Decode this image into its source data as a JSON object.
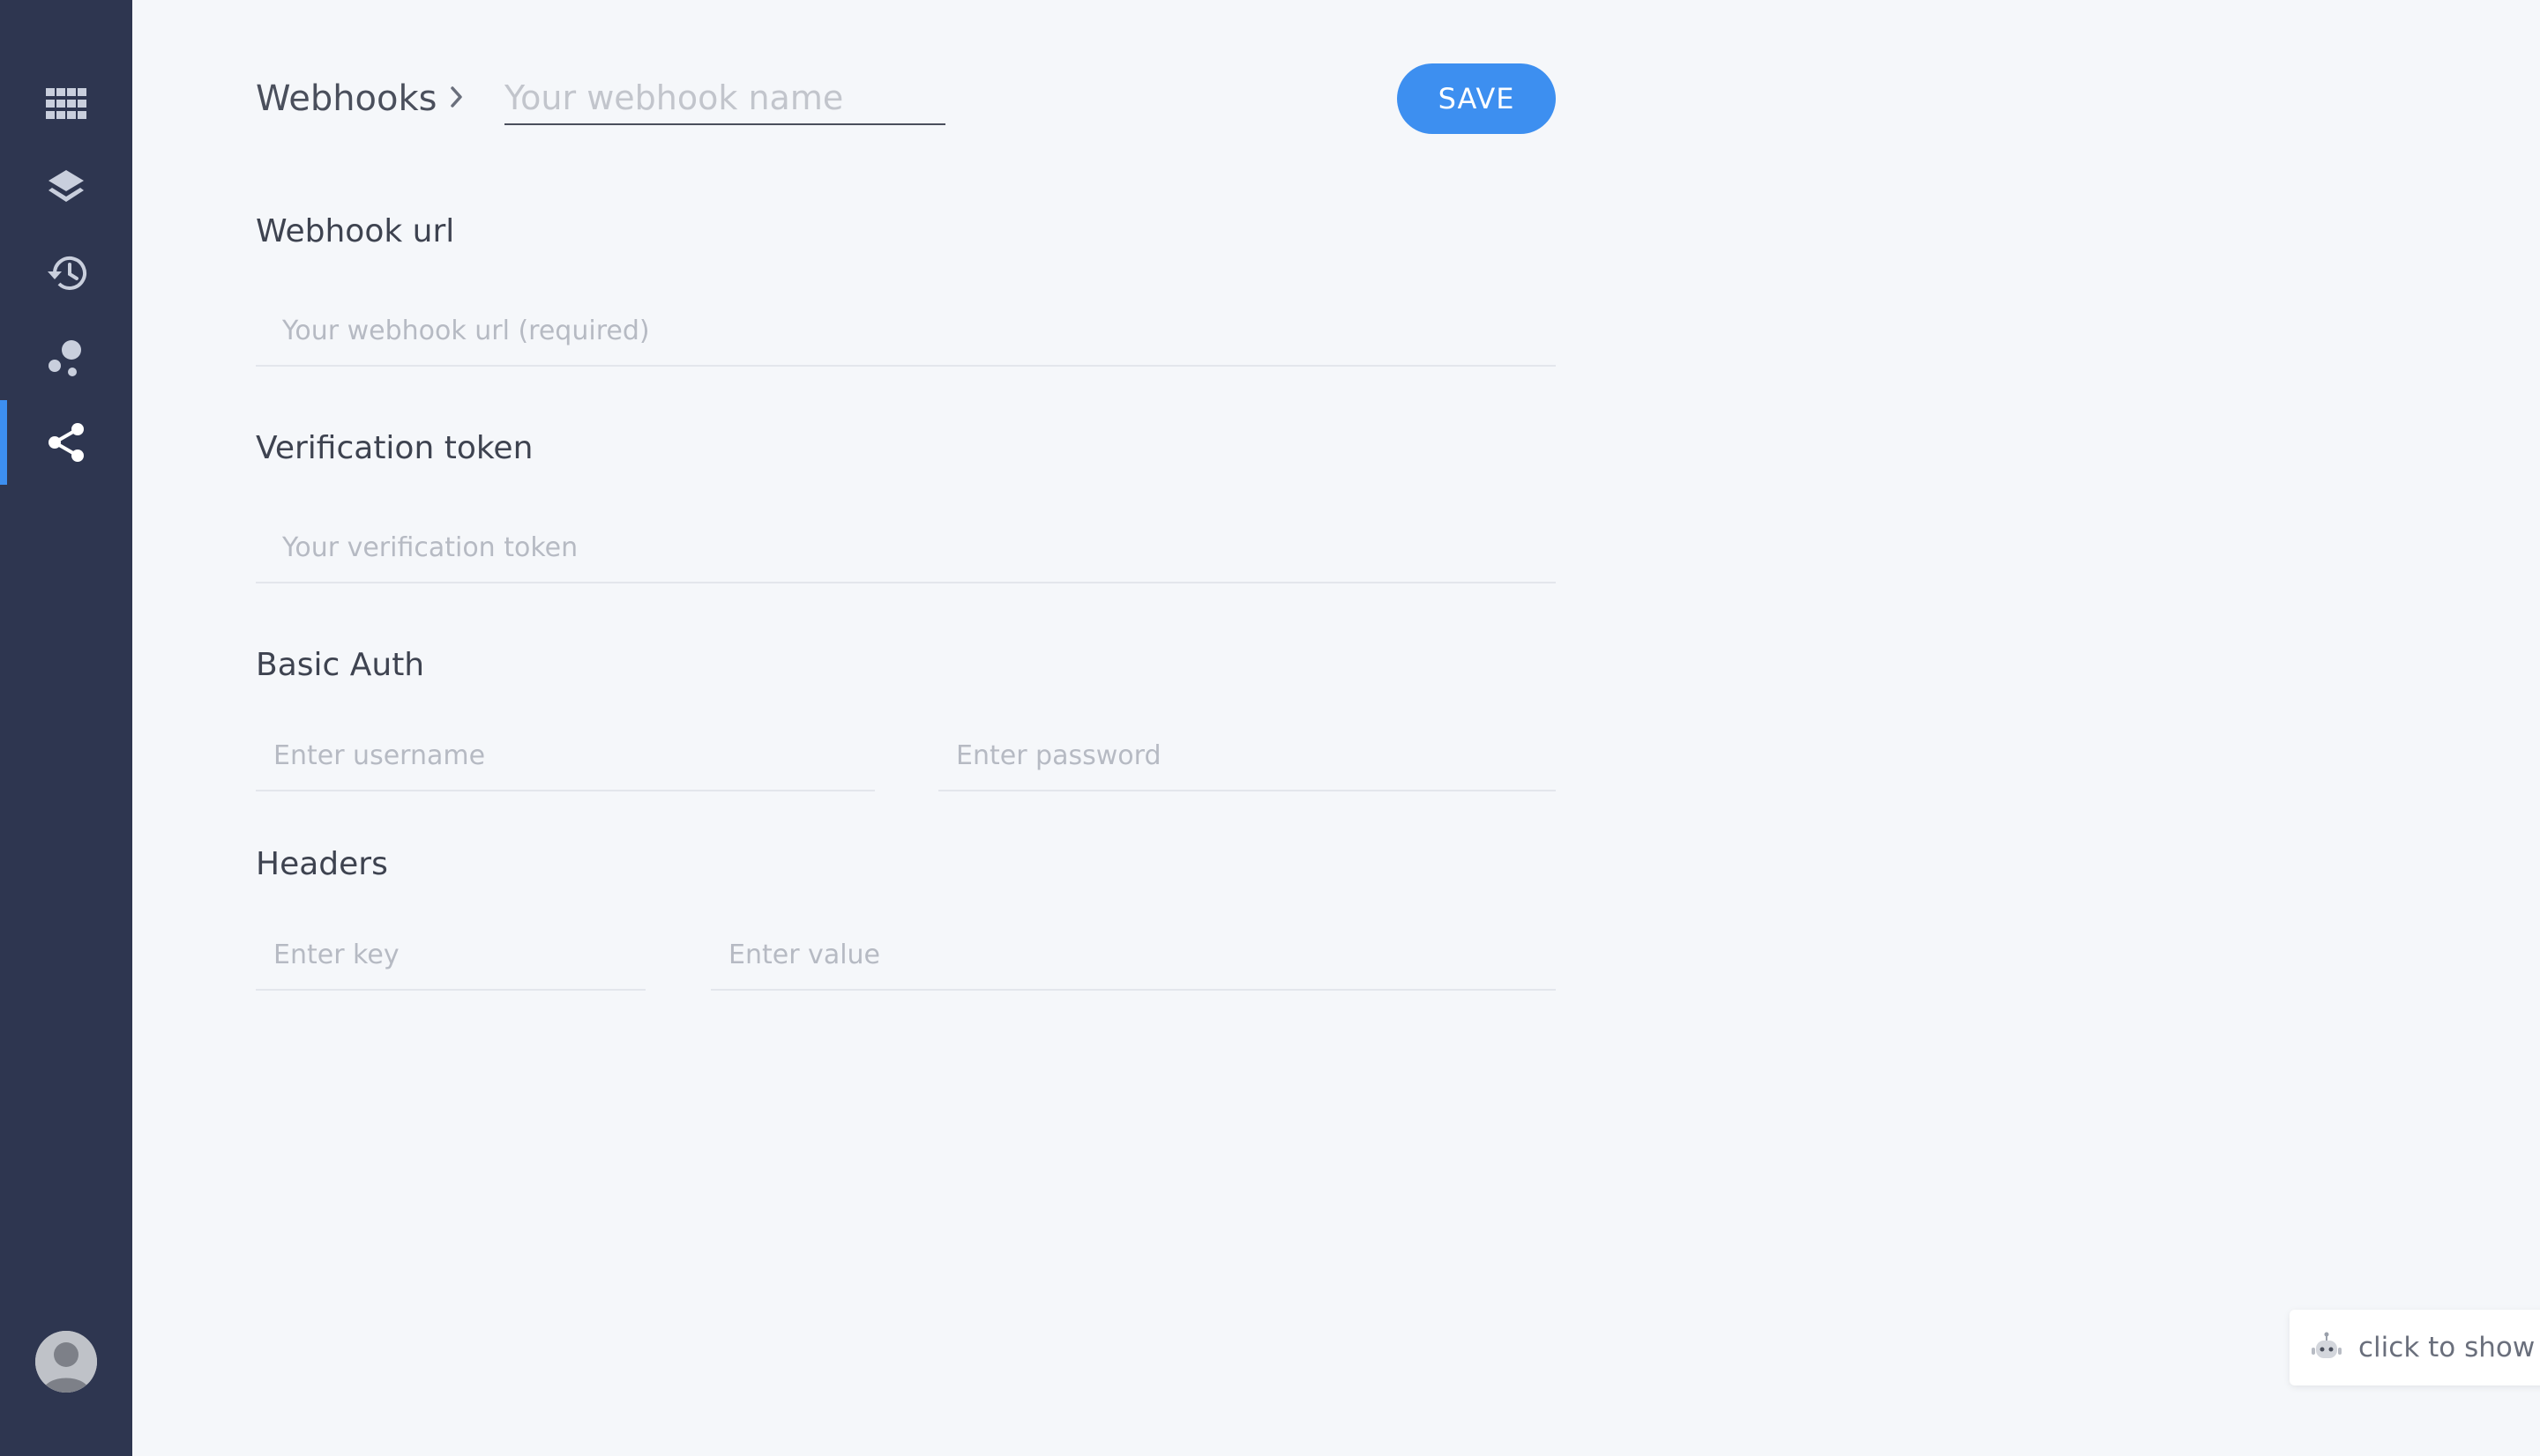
{
  "sidebar": {
    "items": [
      {
        "name": "apps-grid-icon",
        "active": false
      },
      {
        "name": "layers-icon",
        "active": false
      },
      {
        "name": "history-icon",
        "active": false
      },
      {
        "name": "bubbles-icon",
        "active": false
      },
      {
        "name": "share-icon",
        "active": true
      }
    ],
    "accent_color": "#3d8ff0",
    "background_color": "#2e3650"
  },
  "header": {
    "breadcrumb_root": "Webhooks",
    "name_input": {
      "value": "",
      "placeholder": "Your webhook name"
    },
    "save_label": "SAVE"
  },
  "form": {
    "webhook_url": {
      "label": "Webhook url",
      "value": "",
      "placeholder": "Your webhook url (required)"
    },
    "verification_token": {
      "label": "Verification token",
      "value": "",
      "placeholder": "Your verification token"
    },
    "basic_auth": {
      "label": "Basic Auth",
      "username": {
        "value": "",
        "placeholder": "Enter username"
      },
      "password": {
        "value": "",
        "placeholder": "Enter password"
      }
    },
    "headers": {
      "label": "Headers",
      "key": {
        "value": "",
        "placeholder": "Enter key"
      },
      "val": {
        "value": "",
        "placeholder": "Enter value"
      }
    }
  },
  "chat": {
    "label": "click to show chat",
    "icon": "robot-icon"
  }
}
